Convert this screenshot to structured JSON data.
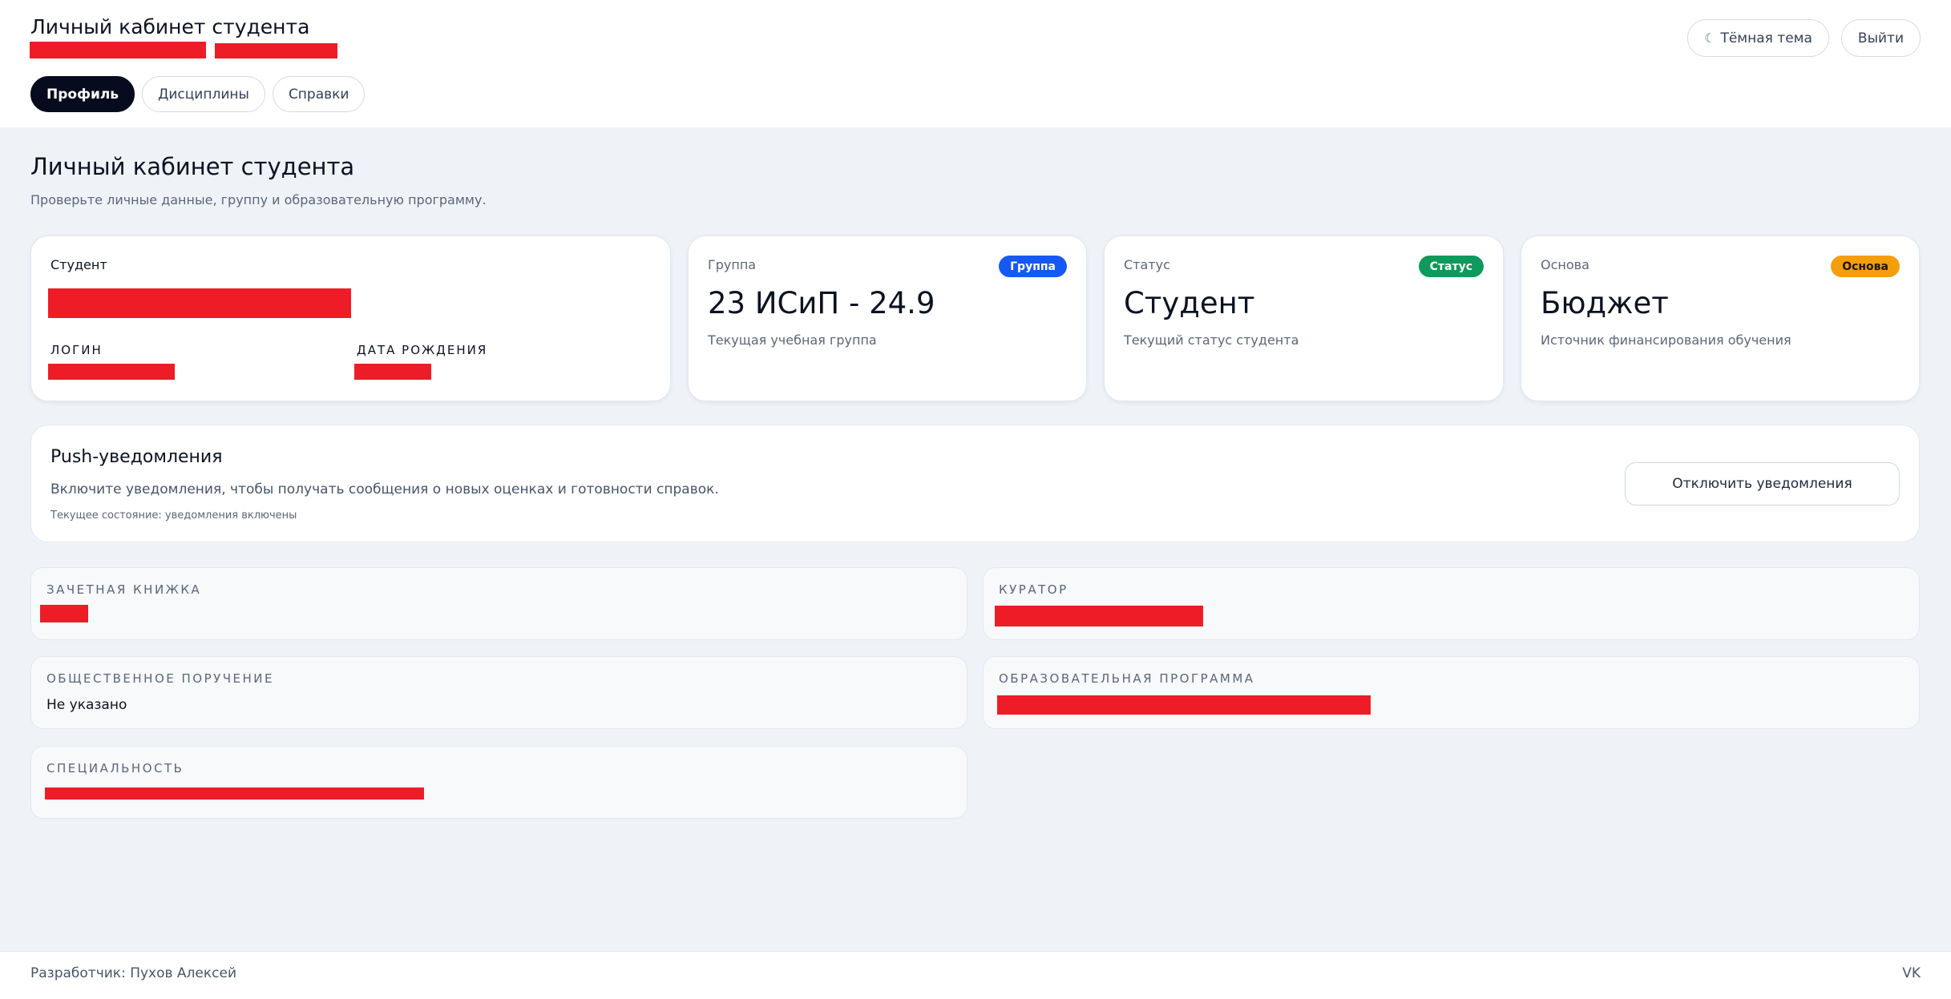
{
  "header": {
    "title": "Личный кабинет студента",
    "tabs": [
      {
        "label": "Профиль",
        "active": true
      },
      {
        "label": "Дисциплины",
        "active": false
      },
      {
        "label": "Справки",
        "active": false
      }
    ],
    "theme_button": "Тёмная тема",
    "theme_icon": "moon-icon",
    "logout_button": "Выйти"
  },
  "page": {
    "title": "Личный кабинет студента",
    "subtitle": "Проверьте личные данные, группу и образовательную программу."
  },
  "student_card": {
    "label": "Студент",
    "login_label": "ЛОГИН",
    "birth_label": "ДАТА РОЖДЕНИЯ"
  },
  "group_card": {
    "label": "Группа",
    "badge": "Группа",
    "badge_color": "#1559f5",
    "value": "23 ИСиП - 24.9",
    "caption": "Текущая учебная группа"
  },
  "status_card": {
    "label": "Статус",
    "badge": "Статус",
    "badge_color": "#0e9a5c",
    "value": "Студент",
    "caption": "Текущий статус студента"
  },
  "basis_card": {
    "label": "Основа",
    "badge": "Основа",
    "badge_color": "#f59e0b",
    "value": "Бюджет",
    "caption": "Источник финансирования обучения"
  },
  "push": {
    "title": "Push-уведомления",
    "description": "Включите уведомления, чтобы получать сообщения о новых оценках и готовности справок.",
    "state": "Текущее состояние: уведомления включены",
    "button": "Отключить уведомления"
  },
  "info": {
    "record_book_label": "ЗАЧЕТНАЯ КНИЖКА",
    "curator_label": "КУРАТОР",
    "public_duty_label": "ОБЩЕСТВЕННОЕ ПОРУЧЕНИЕ",
    "public_duty_value": "Не указано",
    "program_label": "ОБРАЗОВАТЕЛЬНАЯ ПРОГРАММА",
    "specialty_label": "СПЕЦИАЛЬНОСТЬ"
  },
  "footer": {
    "developer": "Разработчик: Пухов Алексей",
    "social": "VK"
  },
  "colors": {
    "accent_dark": "#060b1d",
    "redaction": "#ee1c27",
    "background": "#eff3f8"
  }
}
